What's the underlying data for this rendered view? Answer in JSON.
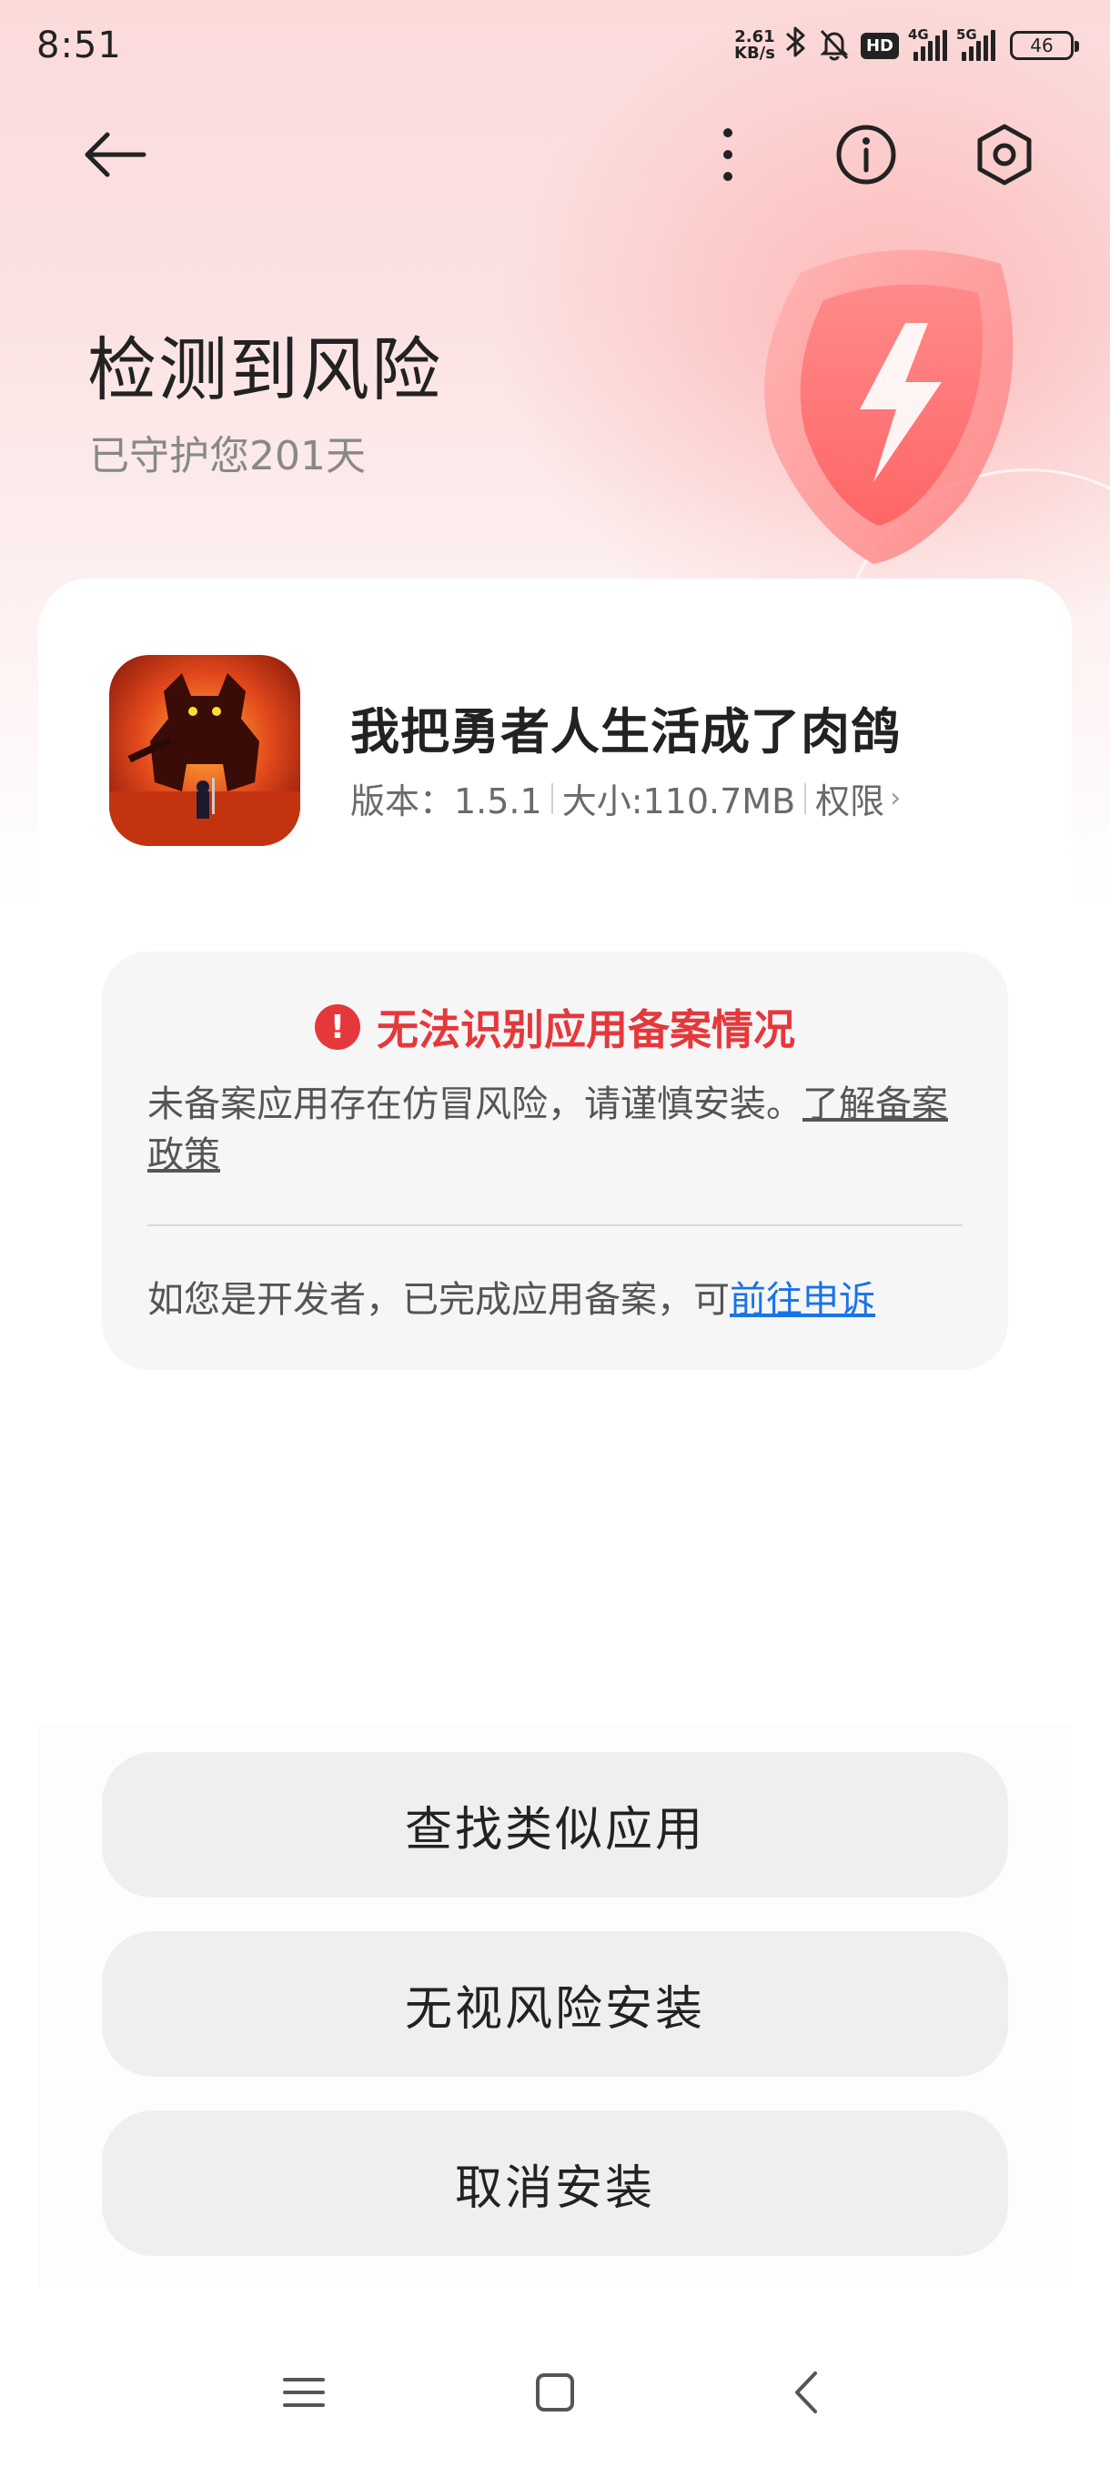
{
  "status_bar": {
    "time": "8:51",
    "net_speed_value": "2.61",
    "net_speed_unit": "KB/s",
    "hd_label": "HD",
    "network_1": "4G",
    "network_2": "5G",
    "battery": "46",
    "icons": [
      "bluetooth-icon",
      "bell-off-icon",
      "signal-icon",
      "battery-icon"
    ]
  },
  "top_nav": {
    "icons": [
      "back-arrow-icon",
      "more-vertical-icon",
      "info-icon",
      "settings-icon"
    ]
  },
  "header": {
    "title": "检测到风险",
    "subtitle": "已守护您201天"
  },
  "app": {
    "name": "我把勇者人生活成了肉鸽",
    "version": "版本：1.5.1",
    "size": "大小:110.7MB",
    "permissions": "权限"
  },
  "warning": {
    "title": "无法识别应用备案情况",
    "body": "未备案应用存在仿冒风险，请谨慎安装。",
    "learn_link": "了解备案政策",
    "dev_text": "如您是开发者，已完成应用备案，可",
    "appeal_link": "前往申诉"
  },
  "actions": {
    "find_similar": "查找类似应用",
    "ignore_install": "无视风险安装",
    "cancel_install": "取消安装"
  },
  "colors": {
    "warning_red": "#e5383b",
    "link_blue": "#1a73e8",
    "button_bg": "#efefef",
    "card_bg": "#f6f6f6"
  }
}
